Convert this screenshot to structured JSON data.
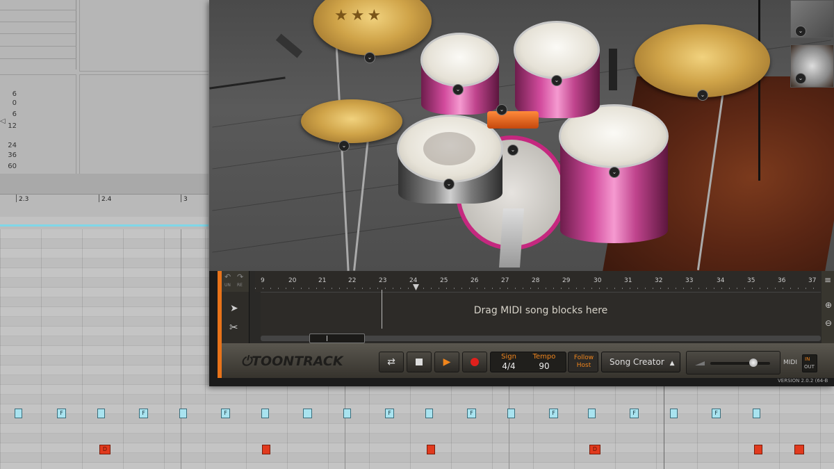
{
  "daw": {
    "velocity_labels": [
      "6",
      "0",
      "6",
      "12",
      "24",
      "36",
      "60"
    ],
    "ruler_labels": [
      "2.3",
      "2.4",
      "3"
    ],
    "notes_row1": [
      "",
      "F",
      "",
      "F",
      "",
      "F",
      "",
      "",
      "",
      "F",
      "",
      "F",
      "",
      "F",
      "",
      "F",
      "",
      "F",
      "",
      "F",
      ""
    ],
    "notes_row2": [
      "D",
      "",
      "",
      "D",
      "",
      ""
    ]
  },
  "plugin": {
    "song_track": {
      "bar_numbers": [
        "9",
        "20",
        "21",
        "22",
        "23",
        "24",
        "25",
        "26",
        "27",
        "28",
        "29",
        "30",
        "31",
        "32",
        "33",
        "34",
        "35",
        "36",
        "37"
      ],
      "undo_label": "UN",
      "redo_label": "RE",
      "placeholder": "Drag MIDI song blocks here"
    },
    "transport": {
      "brand": "TOONTRACK",
      "sign_label": "Sign",
      "sign_value": "4/4",
      "tempo_label": "Tempo",
      "tempo_value": "90",
      "follow_host_label_1": "Follow",
      "follow_host_label_2": "Host",
      "song_creator_label": "Song Creator",
      "midi_label": "MIDI",
      "midi_in": "IN",
      "midi_out": "OUT"
    },
    "version_text": "VERSION 2.0.2 (64-B",
    "colors": {
      "accent_orange": "#e8731a",
      "note_cyan": "#a9e3ef",
      "note_red": "#e13a1e",
      "playhead": "#bbbbbb"
    }
  }
}
